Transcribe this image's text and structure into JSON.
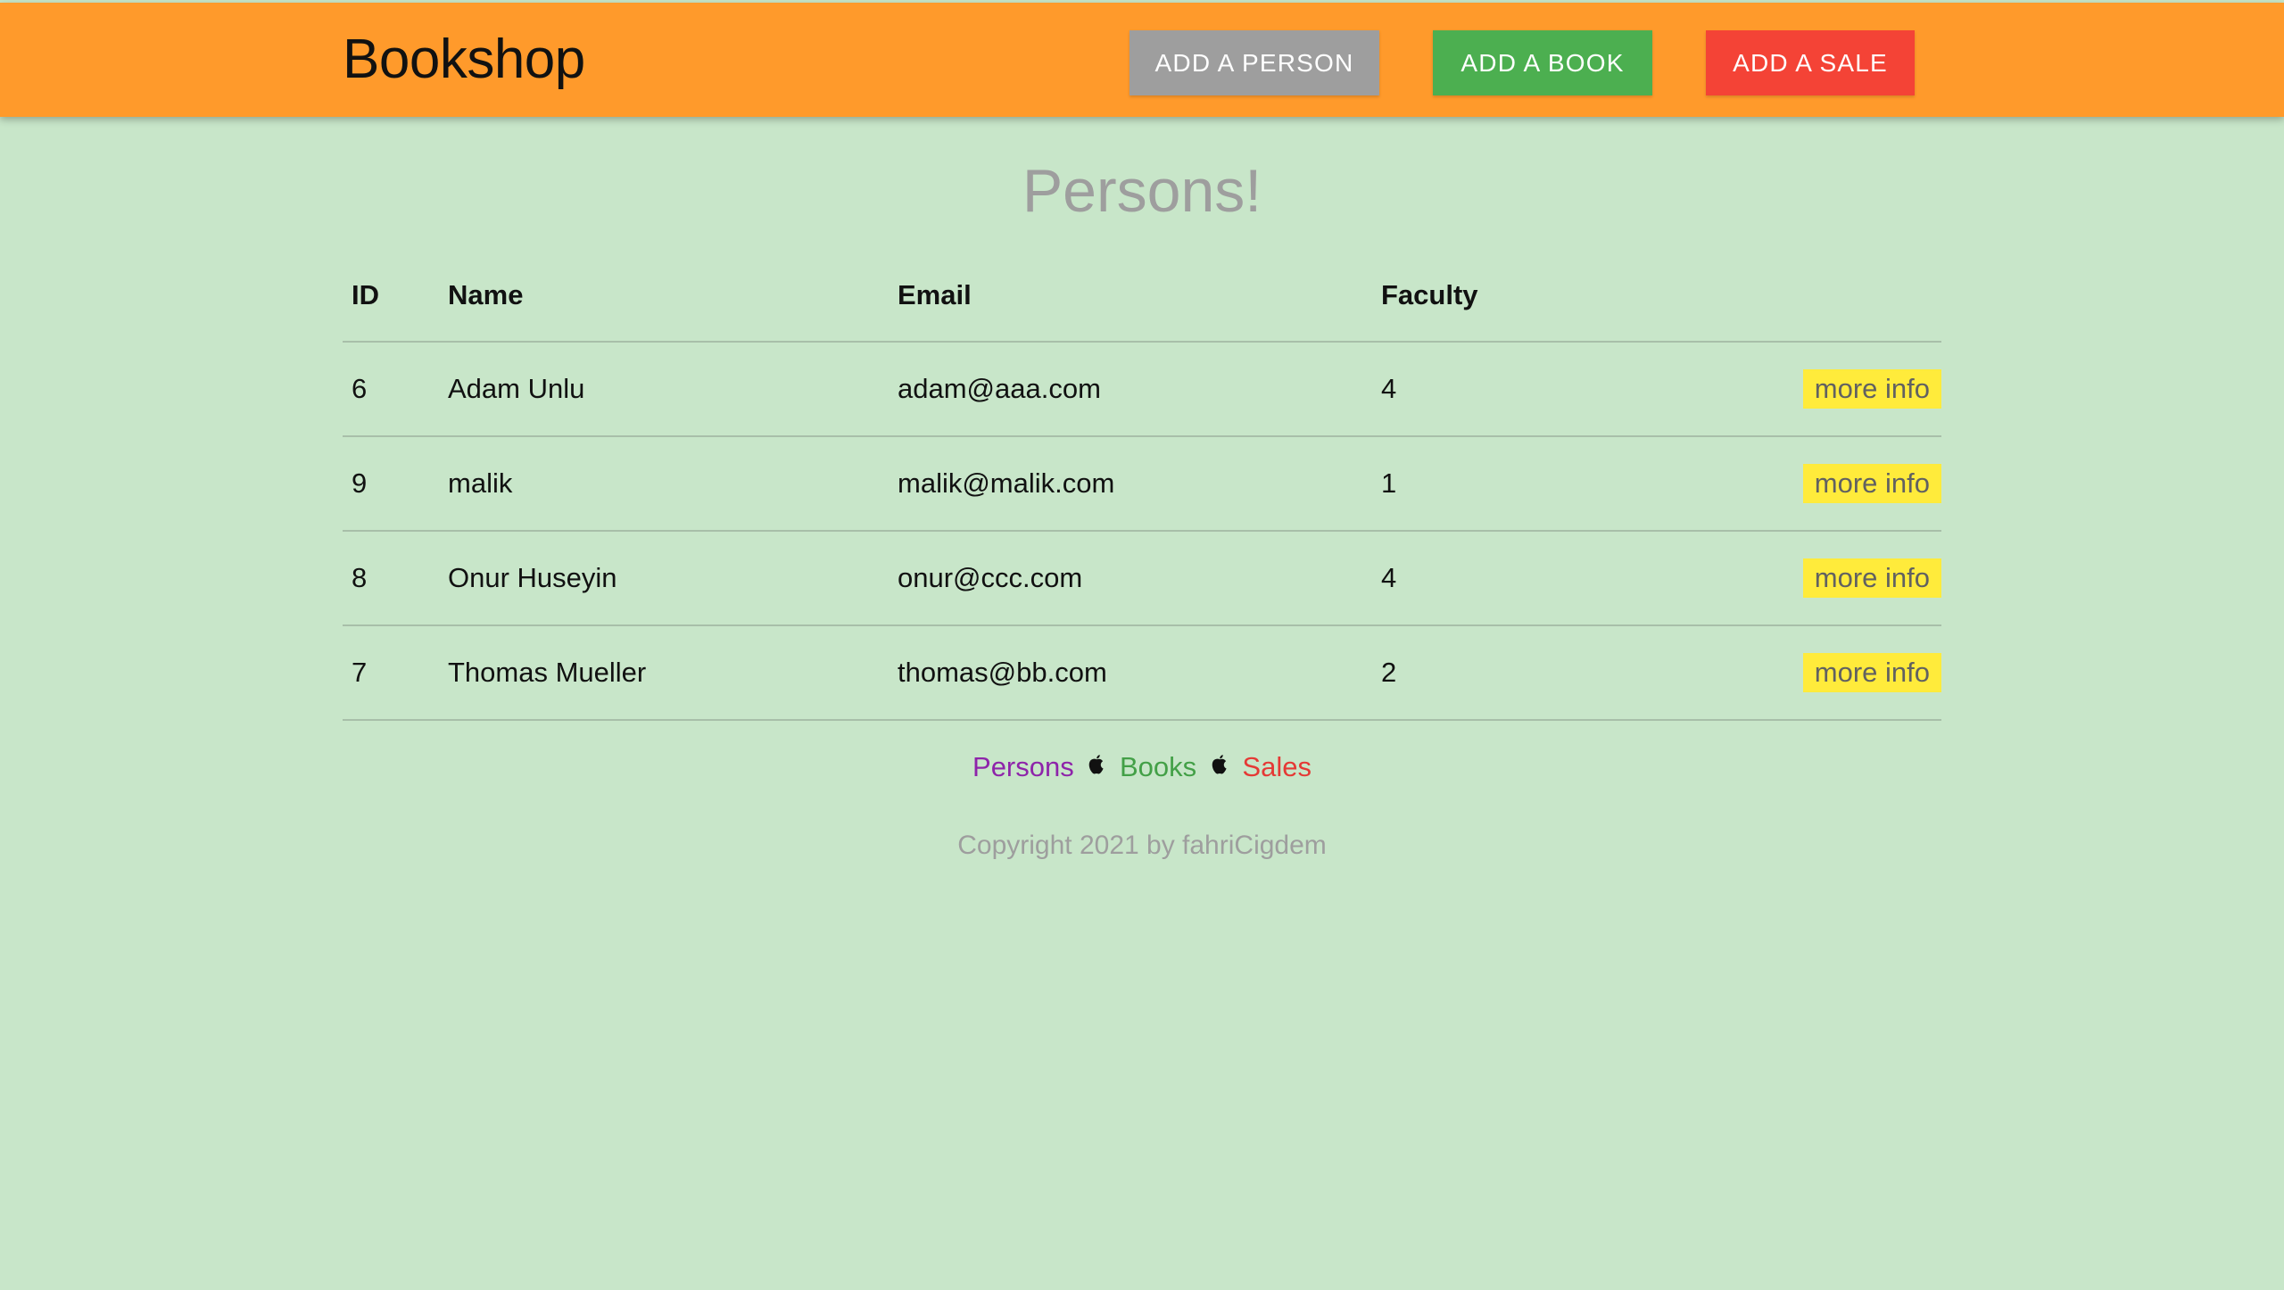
{
  "header": {
    "brand": "Bookshop",
    "buttons": [
      {
        "label": "ADD A PERSON",
        "color": "#9e9e9e"
      },
      {
        "label": "ADD A BOOK",
        "color": "#4caf50"
      },
      {
        "label": "ADD A SALE",
        "color": "#f44336"
      }
    ],
    "bar_color": "#ff9a2b"
  },
  "main": {
    "title": "Persons!",
    "table": {
      "columns": [
        "ID",
        "Name",
        "Email",
        "Faculty",
        ""
      ],
      "rows": [
        {
          "id": "6",
          "name": "Adam Unlu",
          "email": "adam@aaa.com",
          "faculty": "4",
          "action": "more info"
        },
        {
          "id": "9",
          "name": "malik",
          "email": "malik@malik.com",
          "faculty": "1",
          "action": "more info"
        },
        {
          "id": "8",
          "name": "Onur Huseyin",
          "email": "onur@ccc.com",
          "faculty": "4",
          "action": "more info"
        },
        {
          "id": "7",
          "name": "Thomas Mueller",
          "email": "thomas@bb.com",
          "faculty": "2",
          "action": "more info"
        }
      ]
    }
  },
  "footer": {
    "links": [
      {
        "label": "Persons",
        "color": "#8e24aa"
      },
      {
        "label": "Books",
        "color": "#43a047"
      },
      {
        "label": "Sales",
        "color": "#e53935"
      }
    ],
    "separator_icon": "apple-icon",
    "copyright": "Copyright 2021 by fahriCigdem"
  }
}
